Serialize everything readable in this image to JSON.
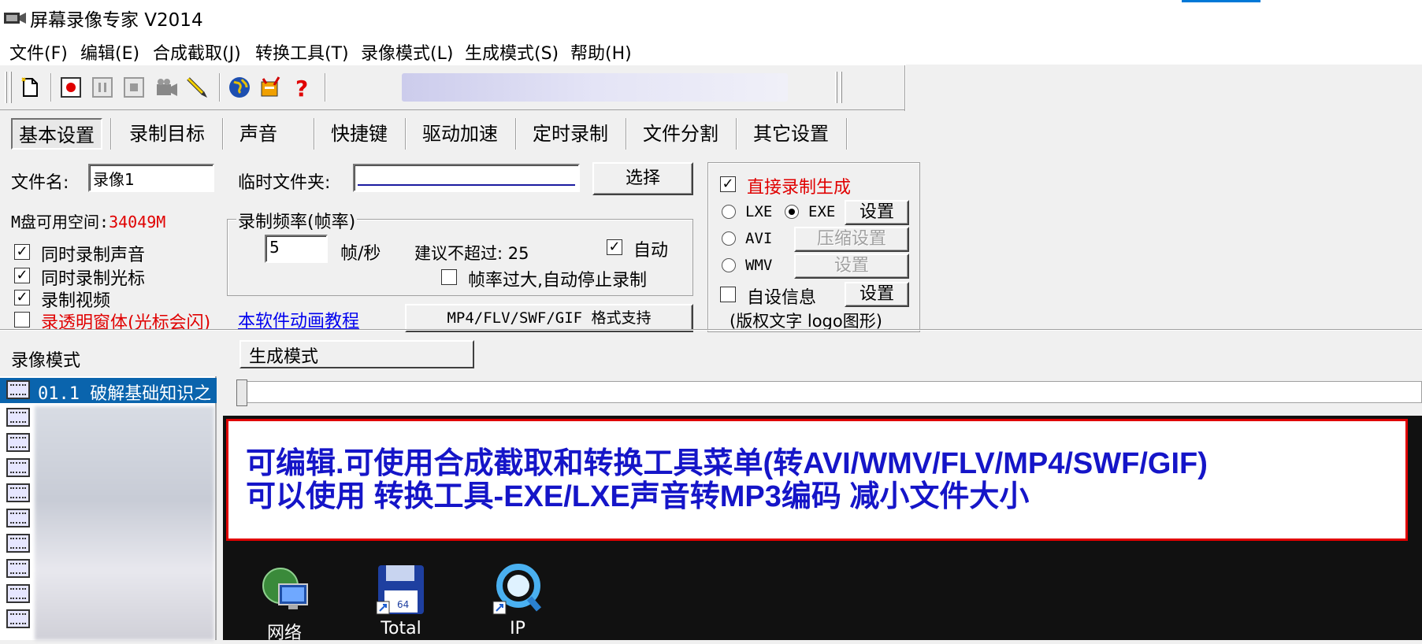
{
  "window": {
    "title": "屏幕录像专家 V2014"
  },
  "menu": [
    "文件(F)",
    "编辑(E)",
    "合成截取(J)",
    "转换工具(T)",
    "录像模式(L)",
    "生成模式(S)",
    "帮助(H)"
  ],
  "toolbar": {
    "icons": [
      "new-icon",
      "record-icon",
      "pause-icon",
      "stop-icon",
      "camera-icon",
      "pen-icon",
      "globe-icon",
      "tools-icon",
      "help-icon"
    ]
  },
  "tabs": [
    "基本设置",
    "录制目标",
    "声音",
    "快捷键",
    "驱动加速",
    "定时录制",
    "文件分割",
    "其它设置"
  ],
  "basic": {
    "filename_label": "文件名:",
    "filename_value": "录像1",
    "tempdir_label": "临时文件夹:",
    "select_button": "选择",
    "disk_label": "M盘可用空间:",
    "disk_value": "34049M",
    "record_audio": "同时录制声音",
    "record_cursor": "同时录制光标",
    "record_video": "录制视频",
    "transparent_window": "录透明窗体(光标会闪)",
    "framerate_group": "录制频率(帧率)",
    "framerate_value": "5",
    "framerate_unit": "帧/秒",
    "suggest_text": "建议不超过: 25",
    "auto_label": "自动",
    "auto_stop_label": "帧率过大,自动停止录制",
    "tutorial_link": "本软件动画教程",
    "format_button": "MP4/FLV/SWF/GIF  格式支持"
  },
  "output": {
    "direct_record": "直接录制生成",
    "lxe_label": "LXE",
    "exe_label": "EXE",
    "settings_button": "设置",
    "avi_label": "AVI",
    "compress_settings": "压缩设置",
    "wmv_label": "WMV",
    "wmv_settings": "设置",
    "custom_info": "自设信息",
    "custom_settings": "设置",
    "copyright_text": "(版权文字 logo图形)"
  },
  "modes": {
    "record_mode": "录像模式",
    "generate_mode": "生成模式"
  },
  "list": {
    "selected_item": "01.1 破解基础知识之"
  },
  "preview": {
    "banner_line1": "可编辑.可使用合成截取和转换工具菜单(转AVI/WMV/FLV/MP4/SWF/GIF)",
    "banner_line2": "可以使用 转换工具-EXE/LXE声音转MP3编码 减小文件大小",
    "desktop_icons": [
      {
        "label": "网络",
        "icon": "network-icon"
      },
      {
        "label": "Total",
        "icon": "floppy-icon"
      },
      {
        "label": "IP",
        "icon": "search-app-icon"
      }
    ]
  },
  "colors": {
    "accent": "#0078d7",
    "warning_red": "#e00000",
    "banner_text": "#1515c8",
    "link_blue": "#0000ee",
    "selection": "#0a64ad"
  }
}
